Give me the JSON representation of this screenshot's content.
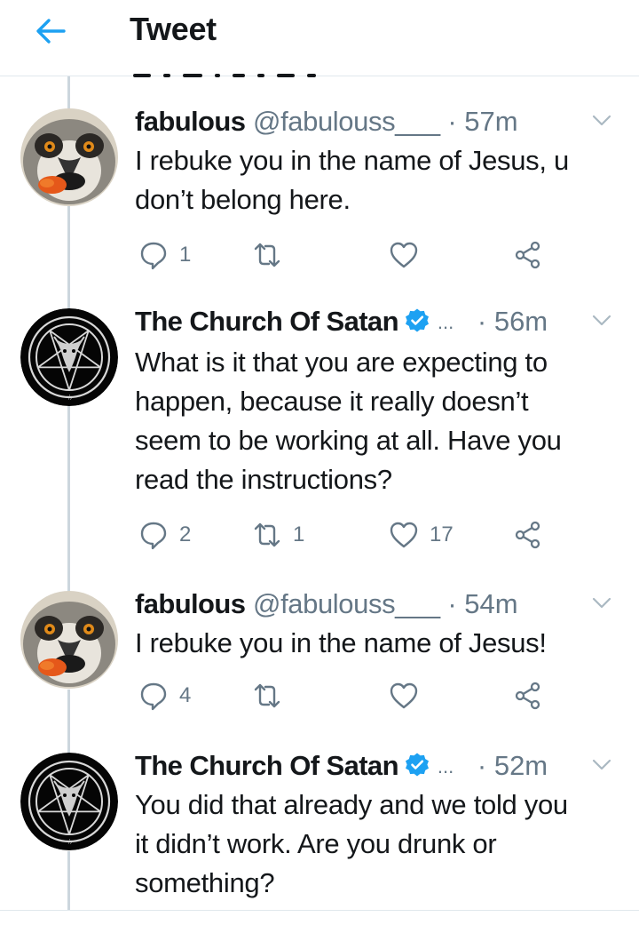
{
  "header": {
    "title": "Tweet",
    "back_icon": "arrow-left-icon",
    "accent": "#1da1f2"
  },
  "tweets": [
    {
      "name": "fabulous",
      "handle": "@fabulouss___",
      "dot": "·",
      "time": "57m",
      "verified": false,
      "text_lines": [
        "I rebuke you in the name of Jesus, u",
        "don’t belong here."
      ],
      "replies": "1",
      "retweets": "",
      "likes": ""
    },
    {
      "name": "The Church Of Satan",
      "handle": "",
      "dot": "·",
      "time": "56m",
      "verified": true,
      "truncation": "...",
      "text_lines": [
        "What is it that you are expecting to",
        "happen, because it really doesn’t",
        "seem to be working at all. Have you",
        "read the instructions?"
      ],
      "replies": "2",
      "retweets": "1",
      "likes": "17"
    },
    {
      "name": "fabulous",
      "handle": "@fabulouss___",
      "dot": "·",
      "time": "54m",
      "verified": false,
      "text_lines": [
        "I rebuke you in the name of Jesus!"
      ],
      "replies": "4",
      "retweets": "",
      "likes": ""
    },
    {
      "name": "The Church Of Satan",
      "handle": "",
      "dot": "·",
      "time": "52m",
      "verified": true,
      "truncation": "...",
      "text_lines": [
        "You did that already and we told you",
        "it didn’t work. Are you drunk or",
        "something?"
      ],
      "replies": "",
      "retweets": "",
      "likes": ""
    }
  ],
  "icons": {
    "reply": "reply-icon",
    "retweet": "retweet-icon",
    "like": "heart-icon",
    "share": "share-icon",
    "menu": "chevron-down-icon",
    "verified": "verified-badge-icon"
  },
  "colors": {
    "text": "#14171a",
    "muted": "#657786",
    "verified": "#1da1f2",
    "thread": "#ccd6dd"
  }
}
